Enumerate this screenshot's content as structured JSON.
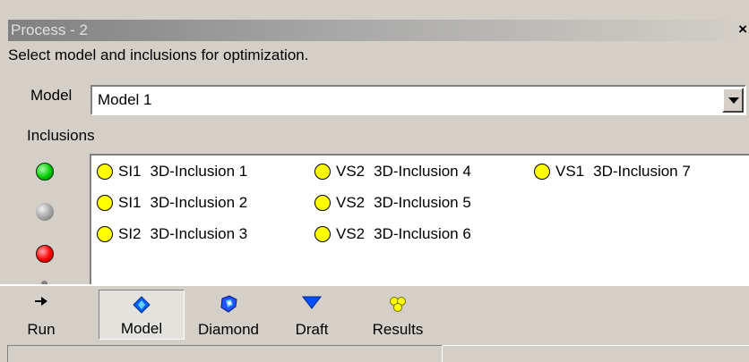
{
  "window": {
    "title": "Process - 2",
    "close_glyph": "×"
  },
  "instruction": "Select model and inclusions for optimization.",
  "model": {
    "label": "Model",
    "selected": "Model 1"
  },
  "inclusions": {
    "label": "Inclusions",
    "status_colors": [
      "#00cc00",
      "#a0a0a0",
      "#ff0000"
    ],
    "items": [
      {
        "class": "SI1",
        "name": "3D-Inclusion 1"
      },
      {
        "class": "SI1",
        "name": "3D-Inclusion 2"
      },
      {
        "class": "SI2",
        "name": "3D-Inclusion 3"
      },
      {
        "class": "VS2",
        "name": "3D-Inclusion 4"
      },
      {
        "class": "VS2",
        "name": "3D-Inclusion 5"
      },
      {
        "class": "VS2",
        "name": "3D-Inclusion 6"
      },
      {
        "class": "VS1",
        "name": "3D-Inclusion 7"
      }
    ],
    "marker_color": "#ffff00"
  },
  "toolbar": {
    "run": "Run",
    "model": "Model",
    "diamond": "Diamond",
    "draft": "Draft",
    "results": "Results",
    "active": "model"
  },
  "icons": {
    "run": "arrow-right-icon",
    "model": "blue-diamond-icon",
    "diamond": "faceted-diamond-icon",
    "draft": "blue-triangle-icon",
    "results": "yellow-cluster-icon"
  }
}
